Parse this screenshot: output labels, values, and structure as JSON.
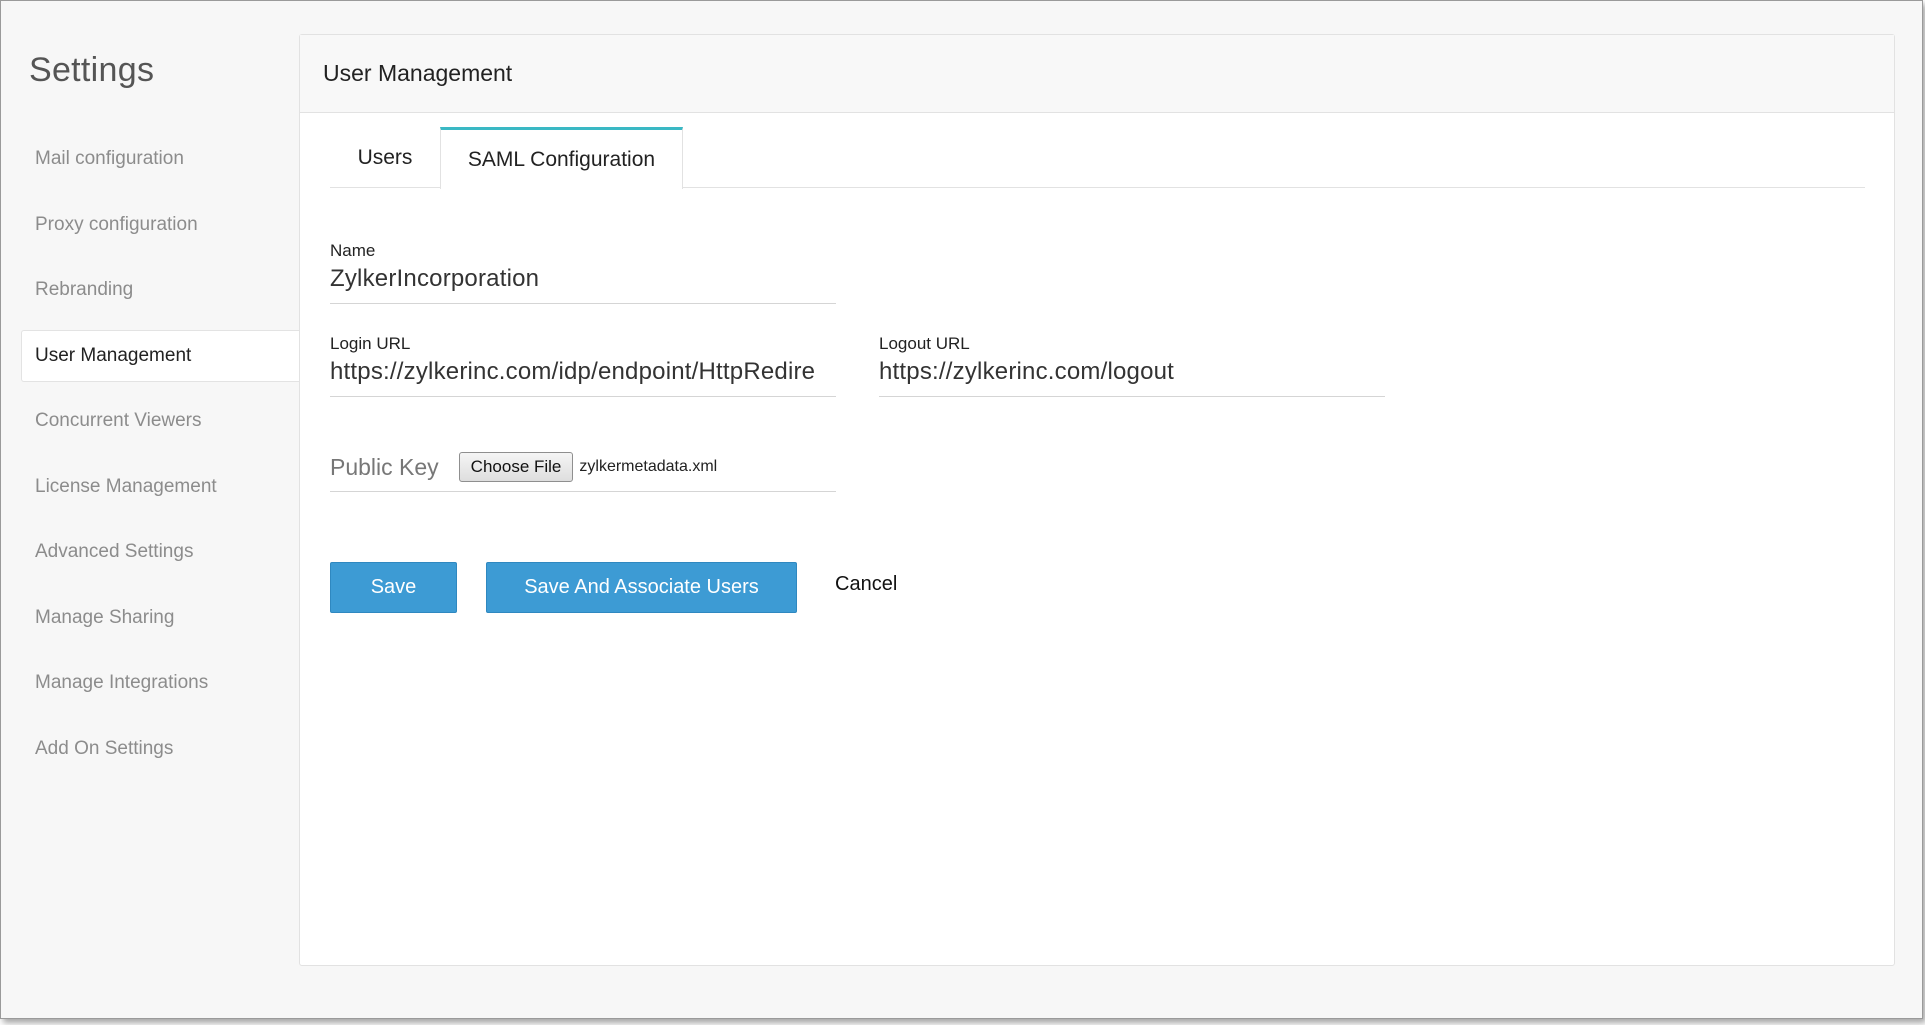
{
  "sidebar": {
    "title": "Settings",
    "items": [
      {
        "label": "Mail configuration"
      },
      {
        "label": "Proxy configuration"
      },
      {
        "label": "Rebranding"
      },
      {
        "label": "User Management"
      },
      {
        "label": "Concurrent Viewers"
      },
      {
        "label": "License Management"
      },
      {
        "label": "Advanced Settings"
      },
      {
        "label": "Manage Sharing"
      },
      {
        "label": "Manage Integrations"
      },
      {
        "label": "Add On Settings"
      }
    ],
    "active_index": 3
  },
  "panel": {
    "title": "User Management",
    "tabs": [
      {
        "label": "Users"
      },
      {
        "label": "SAML Configuration"
      }
    ],
    "active_tab": "SAML Configuration"
  },
  "form": {
    "name": {
      "label": "Name",
      "value": "ZylkerIncorporation"
    },
    "login_url": {
      "label": "Login URL",
      "value": "https://zylkerinc.com/idp/endpoint/HttpRedire"
    },
    "logout_url": {
      "label": "Logout URL",
      "value": "https://zylkerinc.com/logout"
    },
    "public_key": {
      "label": "Public Key",
      "button_label": "Choose File",
      "file_name": "zylkermetadata.xml"
    }
  },
  "actions": {
    "save_label": "Save",
    "associate_label": "Save And Associate Users",
    "cancel_label": "Cancel"
  },
  "colors": {
    "accent_tab": "#3ab8c4",
    "primary_button": "#3d9bd4"
  }
}
